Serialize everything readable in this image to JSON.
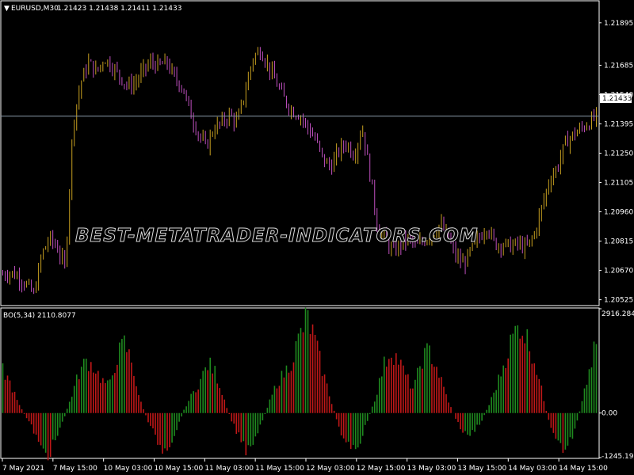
{
  "window": {
    "symbol_header": "EURUSD,M30",
    "ohlc_header": "1.21423 1.21438 1.21411 1.21433",
    "indicator_header": "BO(5,34) 2110.8077",
    "watermark": "BEST-METATRADER-INDICATORS.COM",
    "current_price_label": "1.21433"
  },
  "colors": {
    "background": "#000000",
    "bull_candle": "#c8a020",
    "bear_candle": "#c050c0",
    "hist_up": "#1f8a1f",
    "hist_down": "#c01818",
    "grid_frame": "#ffffff",
    "price_line": "#8a9aa8"
  },
  "chart_data": [
    {
      "type": "candlestick",
      "title": "EURUSD,M30",
      "ylim": [
        1.205,
        1.22
      ],
      "price_ticks": [
        "1.21895",
        "1.21685",
        "1.21540",
        "1.21395",
        "1.21250",
        "1.21105",
        "1.20960",
        "1.20815",
        "1.20670",
        "1.20525"
      ],
      "current_price": 1.21433,
      "close_path": [
        1.2065,
        1.2066,
        1.2064,
        1.206,
        1.2055,
        1.2075,
        1.2083,
        1.2078,
        1.2068,
        1.214,
        1.216,
        1.217,
        1.2165,
        1.2172,
        1.2168,
        1.2163,
        1.2158,
        1.216,
        1.2166,
        1.217,
        1.2168,
        1.217,
        1.2162,
        1.2158,
        1.2145,
        1.2135,
        1.2128,
        1.2137,
        1.214,
        1.2144,
        1.214,
        1.2155,
        1.2172,
        1.2176,
        1.2168,
        1.216,
        1.2152,
        1.2146,
        1.2144,
        1.2138,
        1.2132,
        1.2122,
        1.2118,
        1.2126,
        1.213,
        1.2124,
        1.2138,
        1.2115,
        1.2088,
        1.2082,
        1.2076,
        1.208,
        1.2083,
        1.2079,
        1.2082,
        1.2085,
        1.209,
        1.2084,
        1.2074,
        1.207,
        1.2077,
        1.2083,
        1.2089,
        1.208,
        1.208,
        1.2079,
        1.208,
        1.2078,
        1.2084,
        1.2098,
        1.2112,
        1.2118,
        1.213,
        1.2134,
        1.2137,
        1.214,
        1.2143
      ]
    },
    {
      "type": "bar",
      "title": "BO(5,34)",
      "ylim": [
        -1245.1957,
        2916.2848
      ],
      "value_ticks": [
        "2916.2848",
        "0.00",
        "-1245.1957"
      ],
      "last_value": 2110.8077,
      "values_path": [
        1300,
        900,
        300,
        -100,
        -500,
        -1100,
        -1245,
        -800,
        -200,
        500,
        1200,
        1600,
        1400,
        1000,
        800,
        1700,
        2100,
        1500,
        400,
        -200,
        -700,
        -1100,
        -900,
        -400,
        200,
        600,
        1000,
        1500,
        1200,
        500,
        -200,
        -700,
        -1100,
        -800,
        -300,
        300,
        900,
        1200,
        1600,
        2300,
        2916,
        2200,
        1300,
        500,
        -300,
        -900,
        -1200,
        -800,
        -200,
        500,
        1400,
        1900,
        1600,
        1100,
        700,
        1600,
        1900,
        1400,
        700,
        100,
        -400,
        -700,
        -500,
        -200,
        300,
        900,
        1600,
        2300,
        2700,
        2200,
        1500,
        500,
        -500,
        -1000,
        -1100,
        -600,
        200,
        1200,
        2111
      ]
    }
  ],
  "time_axis": {
    "labels": [
      "7 May 2021",
      "7 May 15:00",
      "10 May 03:00",
      "10 May 15:00",
      "11 May 03:00",
      "11 May 15:00",
      "12 May 03:00",
      "12 May 15:00",
      "13 May 03:00",
      "13 May 15:00",
      "14 May 03:00",
      "14 May 15:00"
    ]
  }
}
